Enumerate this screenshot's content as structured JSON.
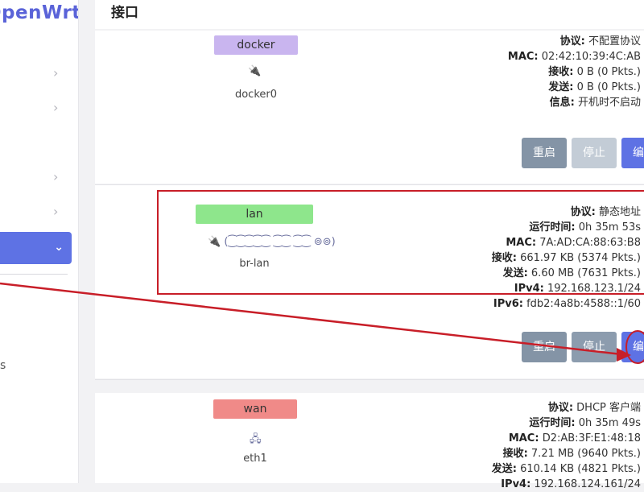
{
  "app": {
    "brand": "OpenWrt"
  },
  "sidebar": {
    "partial_text": "s"
  },
  "header": {
    "title": "接口"
  },
  "interfaces": [
    {
      "tag": "docker",
      "device": "docker0",
      "glyph": "🔌",
      "info": [
        {
          "k": "协议:",
          "v": " 不配置协议"
        },
        {
          "k": "MAC:",
          "v": " 02:42:10:39:4C:AB"
        },
        {
          "k": "接收:",
          "v": " 0 B (0 Pkts.)"
        },
        {
          "k": "发送:",
          "v": " 0 B (0 Pkts.)"
        },
        {
          "k": "信息:",
          "v": " 开机时不启动"
        }
      ],
      "buttons": {
        "restart": "重启",
        "stop": "停止",
        "edit": "编"
      }
    },
    {
      "tag": "lan",
      "device": "br-lan",
      "glyph": "🔌 (⁐⁐⁐⁐⁐ ⁐⁐ ⁐⁐ ⊚⊚)",
      "info": [
        {
          "k": "协议:",
          "v": " 静态地址"
        },
        {
          "k": "运行时间:",
          "v": " 0h 35m 53s"
        },
        {
          "k": "MAC:",
          "v": " 7A:AD:CA:88:63:B8"
        },
        {
          "k": "接收:",
          "v": " 661.97 KB (5374 Pkts.)"
        },
        {
          "k": "发送:",
          "v": " 6.60 MB (7631 Pkts.)"
        },
        {
          "k": "IPv4:",
          "v": " 192.168.123.1/24"
        },
        {
          "k": "IPv6:",
          "v": " fdb2:4a8b:4588::1/60"
        }
      ],
      "buttons": {
        "restart": "重启",
        "stop": "停止",
        "edit": "编"
      }
    },
    {
      "tag": "wan",
      "device": "eth1",
      "glyph": "🖧",
      "info": [
        {
          "k": "协议:",
          "v": " DHCP 客户端"
        },
        {
          "k": "运行时间:",
          "v": " 0h 35m 49s"
        },
        {
          "k": "MAC:",
          "v": " D2:AB:3F:E1:48:18"
        },
        {
          "k": "接收:",
          "v": " 7.21 MB (9640 Pkts.)"
        },
        {
          "k": "发送:",
          "v": " 610.14 KB (4821 Pkts.)"
        },
        {
          "k": "IPv4:",
          "v": " 192.168.124.161/24"
        }
      ]
    }
  ],
  "colors": {
    "accent": "#5e72e4",
    "annotation": "#c81e28"
  }
}
